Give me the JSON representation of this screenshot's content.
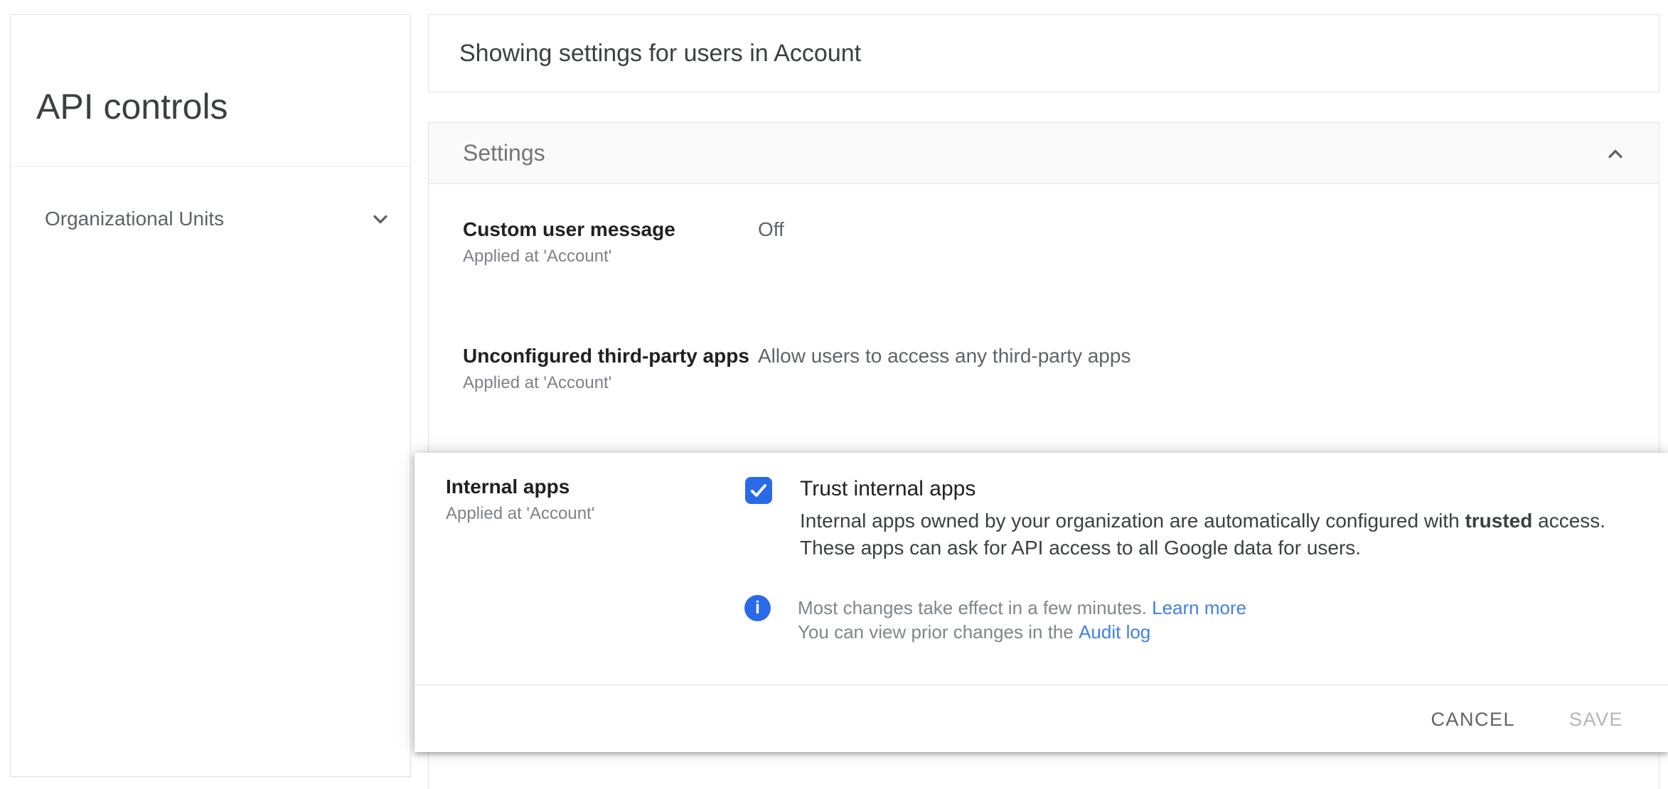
{
  "colors": {
    "accent": "#2a6ae8",
    "link": "#4080e8",
    "disabled": "#b5b5b5"
  },
  "sidebar": {
    "title": "API controls",
    "items": [
      {
        "label": "Organizational Units",
        "icon": "chevron-down-icon"
      }
    ]
  },
  "header": {
    "title": "Showing settings for users in Account"
  },
  "settings": {
    "title": "Settings",
    "collapse_icon": "chevron-up-icon",
    "rows": [
      {
        "label": "Custom user message",
        "applied_at": "Applied at 'Account'",
        "value": "Off"
      },
      {
        "label": "Unconfigured third-party apps",
        "applied_at": "Applied at 'Account'",
        "value": "Allow users to access any third-party apps"
      }
    ]
  },
  "panel": {
    "label": "Internal apps",
    "applied_at": "Applied at 'Account'",
    "checkbox": {
      "checked": true,
      "label": "Trust internal apps"
    },
    "description": {
      "line1_before": "Internal apps owned by your organization are automatically configured with ",
      "line1_bold": "trusted",
      "line1_after": " access.",
      "line2": "These apps can ask for API access to all Google data for users."
    },
    "info": {
      "icon": "info-icon",
      "icon_glyph": "i",
      "line1_text": "Most changes take effect in a few minutes. ",
      "line1_link": "Learn more",
      "line2_text": "You can view prior changes in the ",
      "line2_link": "Audit log"
    },
    "buttons": {
      "cancel": "CANCEL",
      "save": "SAVE"
    }
  }
}
